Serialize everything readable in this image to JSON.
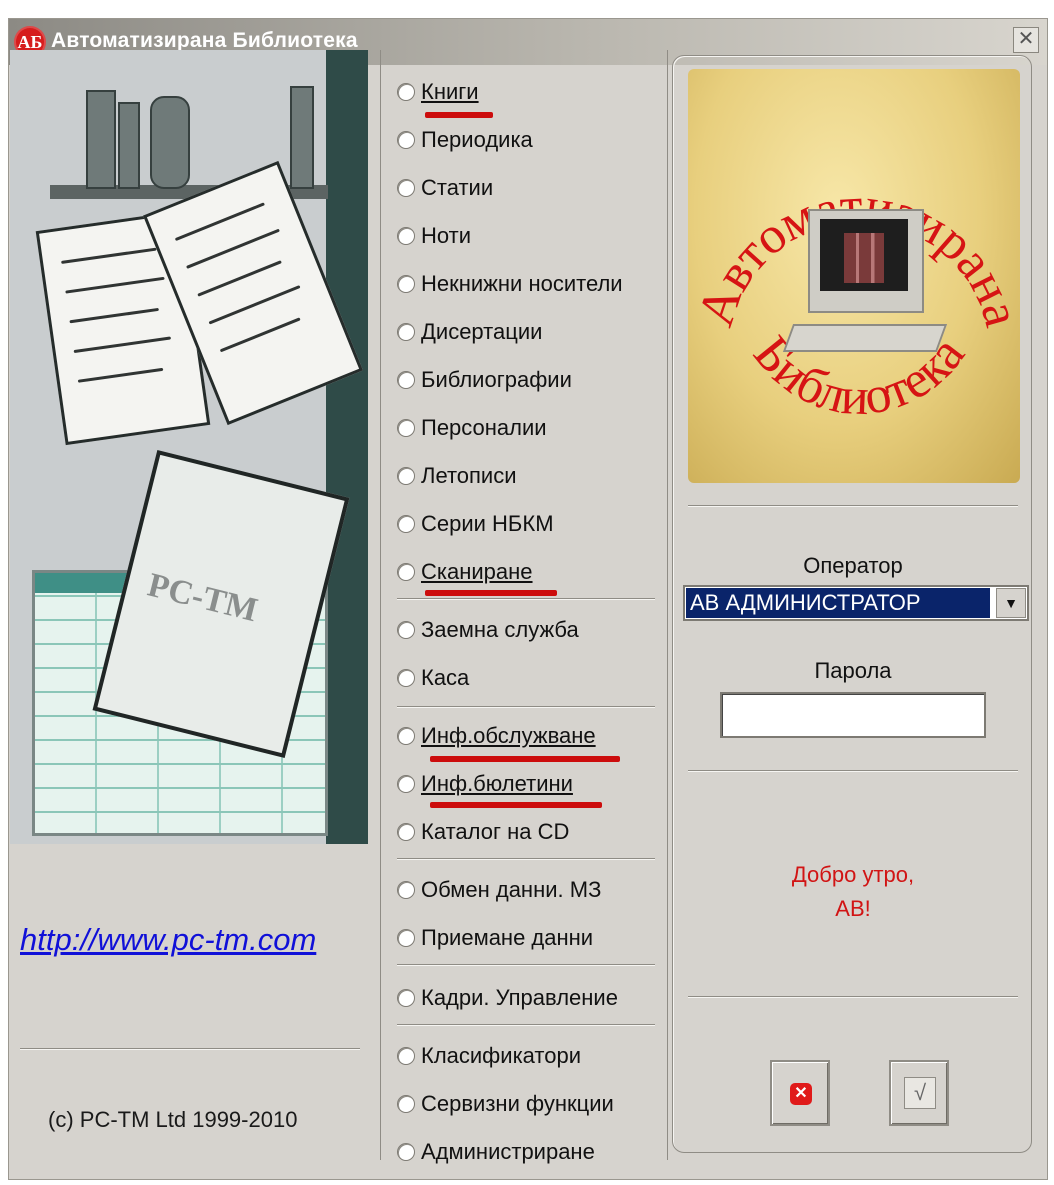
{
  "window": {
    "title": "Автоматизирана Библиотека",
    "logo": "АБ",
    "close_glyph": "✕"
  },
  "left": {
    "link": "http://www.pc-tm.com",
    "copyright": "(c) PC-TM Ltd  1999-2010",
    "art_caption": "PC-TM"
  },
  "menu": {
    "groups": [
      [
        "Книги",
        "Периодика",
        "Статии",
        "Ноти",
        "Некнижни носители",
        "Дисертации",
        "Библиографии",
        "Персоналии",
        "Летописи",
        "Серии НБКМ",
        "Сканиране"
      ],
      [
        "Заемна служба",
        "Каса"
      ],
      [
        "Инф.обслужване",
        "Инф.бюлетини",
        "Каталог на CD"
      ],
      [
        "Обмен данни. МЗ",
        "Приемане данни"
      ],
      [
        "Кадри. Управление"
      ],
      [
        "Класификатори",
        "Сервизни функции",
        "Администриране"
      ]
    ]
  },
  "right": {
    "emblem_text_top": "Автоматизирана",
    "emblem_text_bottom": "Библиотека",
    "emblem_stars": "* *",
    "operator_label": "Оператор",
    "operator_value": "AB АДМИНИСТРАТОР",
    "dropdown_glyph": "▼",
    "password_label": "Парола",
    "password_value": "",
    "greeting_line1": "Добро утро,",
    "greeting_line2": "AB!",
    "cancel_glyph": "✕",
    "ok_glyph": "√"
  },
  "colors": {
    "accent_red": "#d11414",
    "selection": "#0a246a",
    "link": "#1010d8"
  }
}
